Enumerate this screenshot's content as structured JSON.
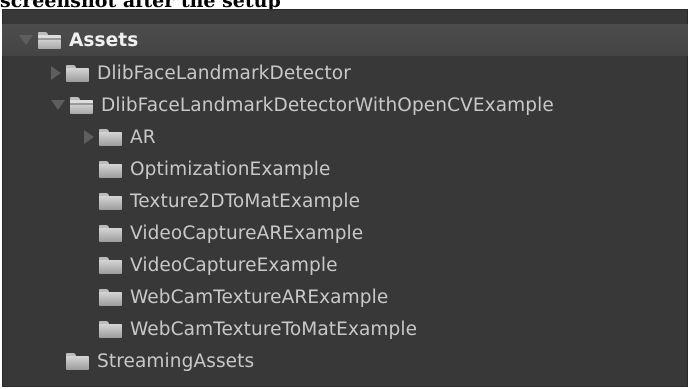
{
  "caption": "screenshot after the setup",
  "tree": {
    "root": {
      "label": "Assets",
      "expanded": true
    },
    "items": [
      {
        "label": "DlibFaceLandmarkDetector",
        "depth": 1,
        "toggle": "right"
      },
      {
        "label": "DlibFaceLandmarkDetectorWithOpenCVExample",
        "depth": 1,
        "toggle": "down"
      },
      {
        "label": "AR",
        "depth": 2,
        "toggle": "right"
      },
      {
        "label": "OptimizationExample",
        "depth": 2,
        "toggle": "none"
      },
      {
        "label": "Texture2DToMatExample",
        "depth": 2,
        "toggle": "none"
      },
      {
        "label": "VideoCaptureARExample",
        "depth": 2,
        "toggle": "none"
      },
      {
        "label": "VideoCaptureExample",
        "depth": 2,
        "toggle": "none"
      },
      {
        "label": "WebCamTextureARExample",
        "depth": 2,
        "toggle": "none"
      },
      {
        "label": "WebCamTextureToMatExample",
        "depth": 2,
        "toggle": "none"
      },
      {
        "label": "StreamingAssets",
        "depth": 1,
        "toggle": "none"
      }
    ]
  },
  "colors": {
    "panel_bg": "#383838",
    "header_bg": "#474747",
    "text": "#c8c8c8",
    "folder": "#c0c0c0"
  }
}
